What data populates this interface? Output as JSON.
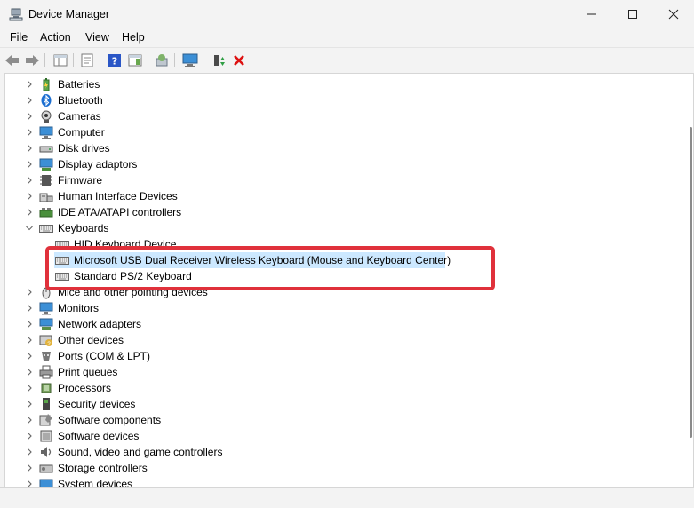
{
  "window": {
    "title": "Device Manager"
  },
  "menu": [
    "File",
    "Action",
    "View",
    "Help"
  ],
  "tree": [
    {
      "label": "Batteries",
      "icon": "battery-icon",
      "depth": 0
    },
    {
      "label": "Bluetooth",
      "icon": "bluetooth-icon",
      "depth": 0
    },
    {
      "label": "Cameras",
      "icon": "camera-icon",
      "depth": 0
    },
    {
      "label": "Computer",
      "icon": "computer-icon",
      "depth": 0
    },
    {
      "label": "Disk drives",
      "icon": "disk-drive-icon",
      "depth": 0
    },
    {
      "label": "Display adaptors",
      "icon": "display-adapter-icon",
      "depth": 0
    },
    {
      "label": "Firmware",
      "icon": "firmware-icon",
      "depth": 0
    },
    {
      "label": "Human Interface Devices",
      "icon": "hid-icon",
      "depth": 0
    },
    {
      "label": "IDE ATA/ATAPI controllers",
      "icon": "ide-controller-icon",
      "depth": 0
    },
    {
      "label": "Keyboards",
      "icon": "keyboard-icon",
      "depth": 0,
      "expanded": true
    },
    {
      "label": "HID Keyboard Device",
      "icon": "keyboard-icon",
      "depth": 1
    },
    {
      "label": "Microsoft USB Dual Receiver Wireless Keyboard (Mouse and Keyboard Center)",
      "icon": "keyboard-icon",
      "depth": 1,
      "selected": true
    },
    {
      "label": "Standard PS/2 Keyboard",
      "icon": "keyboard-icon",
      "depth": 1
    },
    {
      "label": "Mice and other pointing devices",
      "icon": "mouse-icon",
      "depth": 0
    },
    {
      "label": "Monitors",
      "icon": "monitor-icon",
      "depth": 0
    },
    {
      "label": "Network adapters",
      "icon": "network-adapter-icon",
      "depth": 0
    },
    {
      "label": "Other devices",
      "icon": "other-devices-icon",
      "depth": 0
    },
    {
      "label": "Ports (COM & LPT)",
      "icon": "ports-icon",
      "depth": 0
    },
    {
      "label": "Print queues",
      "icon": "printer-icon",
      "depth": 0
    },
    {
      "label": "Processors",
      "icon": "processor-icon",
      "depth": 0
    },
    {
      "label": "Security devices",
      "icon": "security-device-icon",
      "depth": 0
    },
    {
      "label": "Software components",
      "icon": "software-component-icon",
      "depth": 0
    },
    {
      "label": "Software devices",
      "icon": "software-device-icon",
      "depth": 0
    },
    {
      "label": "Sound, video and game controllers",
      "icon": "sound-icon",
      "depth": 0
    },
    {
      "label": "Storage controllers",
      "icon": "storage-controller-icon",
      "depth": 0
    },
    {
      "label": "System devices",
      "icon": "system-device-icon",
      "depth": 0
    }
  ],
  "colors": {
    "selection": "#cce8ff",
    "highlight_box": "#e0313b"
  }
}
